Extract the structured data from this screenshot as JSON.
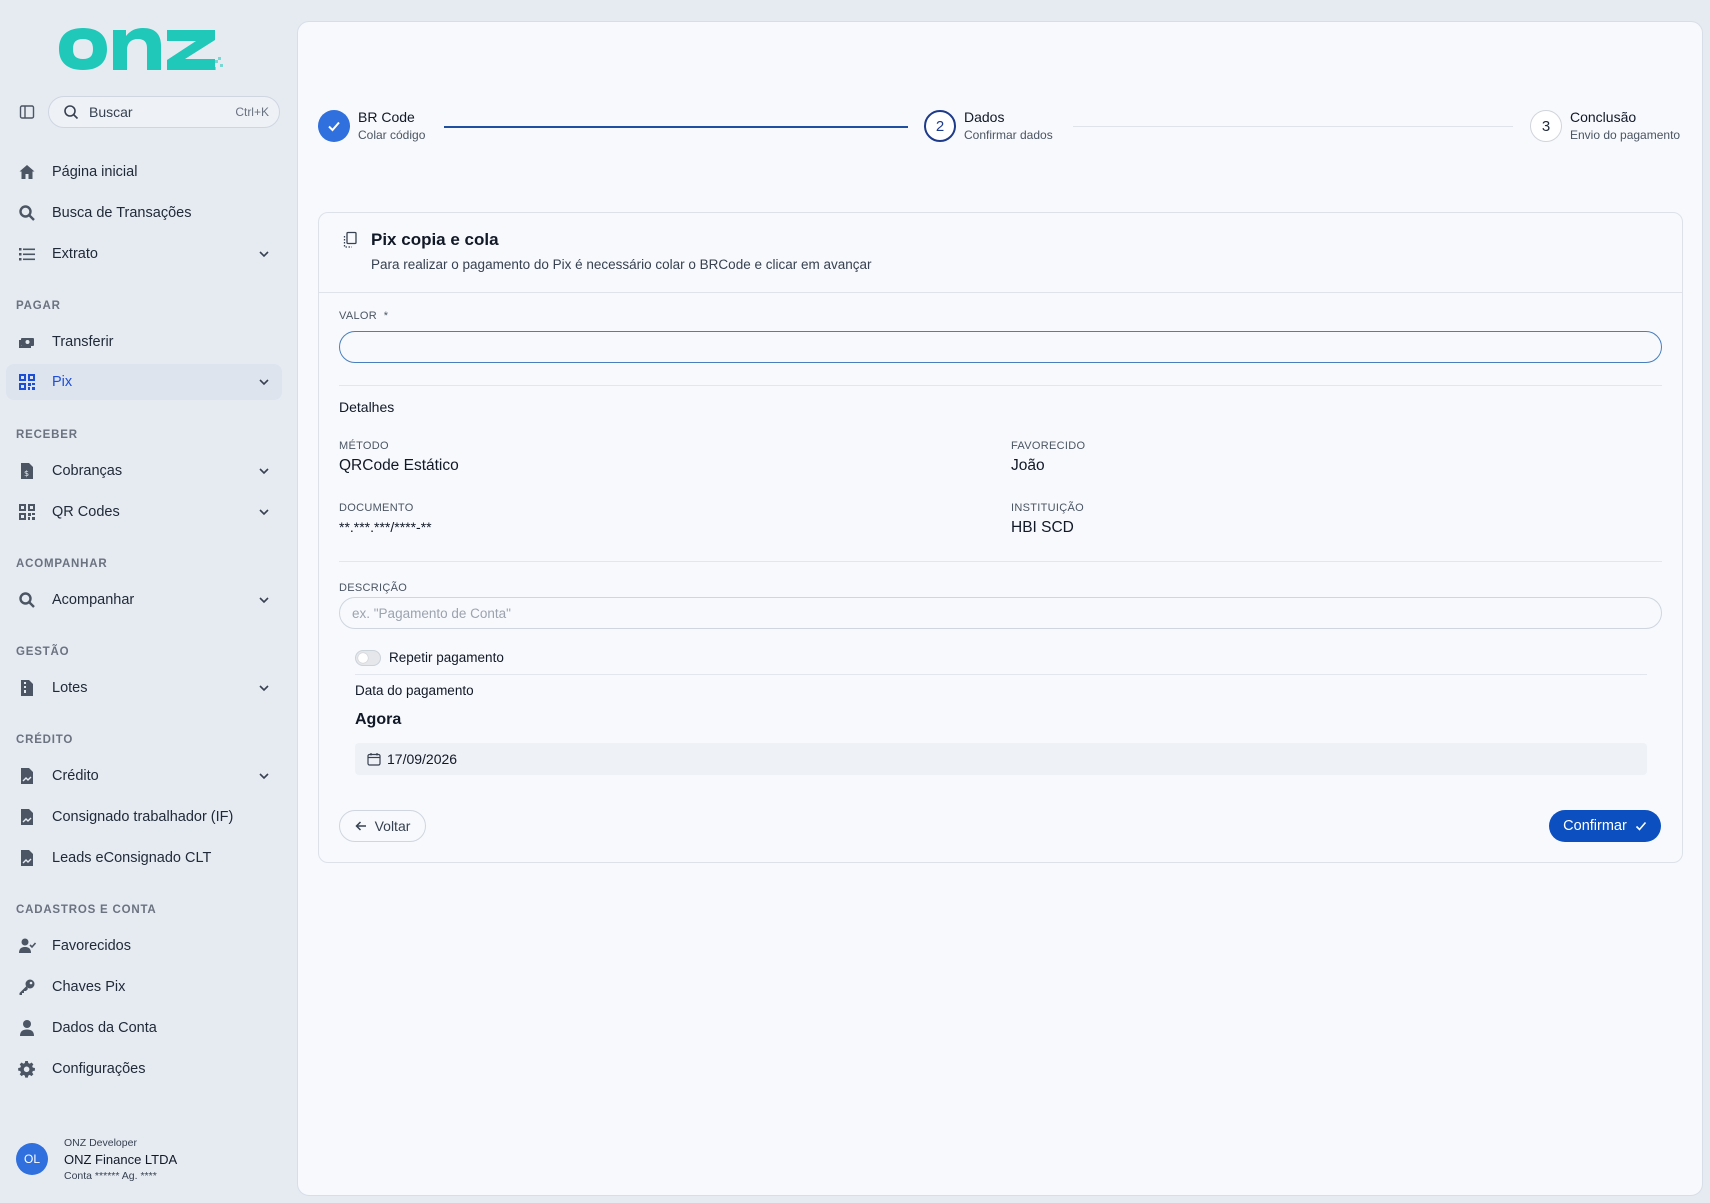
{
  "brand": {
    "logo_text": "onz",
    "color": "#1fc8b8"
  },
  "search": {
    "placeholder": "Buscar",
    "shortcut": "Ctrl+K"
  },
  "nav": {
    "home": "Página inicial",
    "tx_search": "Busca de Transações",
    "extrato": "Extrato",
    "sec_pagar": "PAGAR",
    "transferir": "Transferir",
    "pix": "Pix",
    "sec_receber": "RECEBER",
    "cobrancas": "Cobranças",
    "qrcodes": "QR Codes",
    "sec_acompanhar": "ACOMPANHAR",
    "acompanhar": "Acompanhar",
    "sec_gestao": "GESTÃO",
    "lotes": "Lotes",
    "sec_credito": "CRÉDITO",
    "credito": "Crédito",
    "consignado": "Consignado trabalhador (IF)",
    "leads": "Leads eConsignado CLT",
    "sec_cadastros": "CADASTROS E CONTA",
    "favorecidos": "Favorecidos",
    "chaves": "Chaves Pix",
    "dados_conta": "Dados da Conta",
    "config": "Configurações"
  },
  "profile": {
    "initials": "OL",
    "role": "ONZ Developer",
    "company": "ONZ Finance LTDA",
    "account": "Conta ****** Ag. ****"
  },
  "stepper": {
    "steps": [
      {
        "title": "BR Code",
        "subtitle": "Colar código",
        "state": "done"
      },
      {
        "title": "Dados",
        "subtitle": "Confirmar dados",
        "number": "2",
        "state": "current"
      },
      {
        "title": "Conclusão",
        "subtitle": "Envio do pagamento",
        "number": "3",
        "state": "future"
      }
    ]
  },
  "card": {
    "title": "Pix copia e cola",
    "subtitle": "Para realizar o pagamento do Pix é necessário colar o BRCode e clicar em avançar",
    "valor_label": "VALOR",
    "required_mark": "*",
    "valor_value": "",
    "details_title": "Detalhes",
    "metodo_label": "MÉTODO",
    "metodo_value": "QRCode Estático",
    "favorecido_label": "FAVORECIDO",
    "favorecido_value": "João",
    "documento_label": "DOCUMENTO",
    "documento_value": "**.***.***/****-**",
    "instituicao_label": "INSTITUIÇÃO",
    "instituicao_value": "HBI SCD",
    "descricao_label": "DESCRIÇÃO",
    "descricao_placeholder": "ex. \"Pagamento de Conta\"",
    "repetir_label": "Repetir pagamento",
    "repetir_on": false,
    "data_label": "Data do pagamento",
    "data_mode": "Agora",
    "data_value": "17/09/2026",
    "back_label": "Voltar",
    "confirm_label": "Confirmar"
  }
}
